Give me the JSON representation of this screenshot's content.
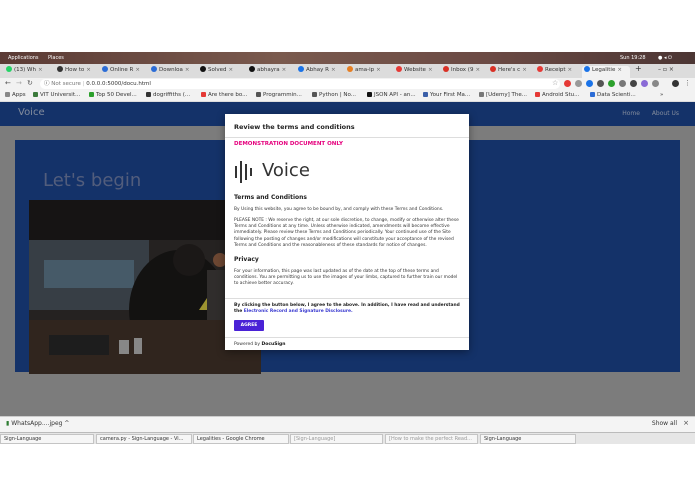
{
  "system_bar": {
    "applications": "Applications",
    "places": "Places",
    "clock": "Sun 19:28"
  },
  "tabs": [
    {
      "label": "(13) Wh",
      "color": "#25d366"
    },
    {
      "label": "How to",
      "color": "#333333"
    },
    {
      "label": "Online R",
      "color": "#2b6cd6"
    },
    {
      "label": "Downloa",
      "color": "#2b6cd6"
    },
    {
      "label": "Solved",
      "color": "#111111"
    },
    {
      "label": "abhayra",
      "color": "#111111"
    },
    {
      "label": "Abhay R",
      "color": "#1a73e8"
    },
    {
      "label": "ama-ip",
      "color": "#e67e22"
    },
    {
      "label": "Website",
      "color": "#e53935"
    },
    {
      "label": "Inbox (9",
      "color": "#d93025"
    },
    {
      "label": "Here's c",
      "color": "#d93025"
    },
    {
      "label": "Receipt",
      "color": "#e53935"
    },
    {
      "label": "Legalitie",
      "color": "#1a73e8"
    }
  ],
  "address": {
    "secure_label": "Not secure",
    "url": "0.0.0.0:5000/docu.html"
  },
  "bookmarks": [
    {
      "label": "Apps",
      "color": "#888888"
    },
    {
      "label": "VIT Universit...",
      "color": "#3b7a3b"
    },
    {
      "label": "Top 50 Devel...",
      "color": "#2ca02c"
    },
    {
      "label": "dogriffiths (...",
      "color": "#333333"
    },
    {
      "label": "Are there bo...",
      "color": "#e53935"
    },
    {
      "label": "Programmin...",
      "color": "#555555"
    },
    {
      "label": "Python | No...",
      "color": "#555555"
    },
    {
      "label": "JSON API - an...",
      "color": "#111111"
    },
    {
      "label": "Your First Ma...",
      "color": "#3a5fa8"
    },
    {
      "label": "[Udemy] The...",
      "color": "#777777"
    },
    {
      "label": "Android Stu...",
      "color": "#e53935"
    },
    {
      "label": "Data Scienti...",
      "color": "#2b6cd6"
    }
  ],
  "site": {
    "brand": "Voice",
    "nav": [
      "Home",
      "About Us"
    ],
    "hero_title": "Let's begin"
  },
  "modal": {
    "title": "Review the terms and conditions",
    "demo": "DEMONSTRATION DOCUMENT ONLY",
    "logo_text": "Voice",
    "terms_heading": "Terms and Conditions",
    "terms_p1": "By Using this website, you agree to be bound by, and comply with these Terms and Conditions.",
    "terms_p2": "PLEASE NOTE : We reserve the right, at our sole discretion, to change, modify or otherwise alter these Terms and Conditions at any time. Unless otherwise indicated, amendments will become effective immediately. Please review these Terms and Conditions periodically. Your continued use of the Site following the posting of changes and/or modifications will constitute your acceptance of the revised Terms and Conditions and the reasonableness of these standards for notice of changes.",
    "privacy_heading": "Privacy",
    "privacy_p": "For your information, this page was last updated as of the date at the top of these terms and conditions. You are permitting us to use the images of your limbs, captured to further train our model to achieve better accuracy.",
    "agree_text": "By clicking the button below, I agree to the above. In addition, I have read and understand the",
    "agree_link": "Electronic Record and Signature Disclosure.",
    "agree_button": "AGREE",
    "footer_prefix": "Powered by",
    "footer_brand": "DocuSign"
  },
  "downloads": {
    "file": "WhatsApp....jpeg",
    "show_all": "Show all"
  },
  "taskbar": [
    {
      "label": "Sign-Language",
      "dim": false
    },
    {
      "label": "camera.py - Sign-Language - Vi...",
      "dim": false
    },
    {
      "label": "Legalities - Google Chrome",
      "dim": false
    },
    {
      "label": "[Sign-Language]",
      "dim": true
    },
    {
      "label": "[How to make the perfect Read...",
      "dim": true
    },
    {
      "label": "Sign-Language",
      "dim": false
    }
  ]
}
